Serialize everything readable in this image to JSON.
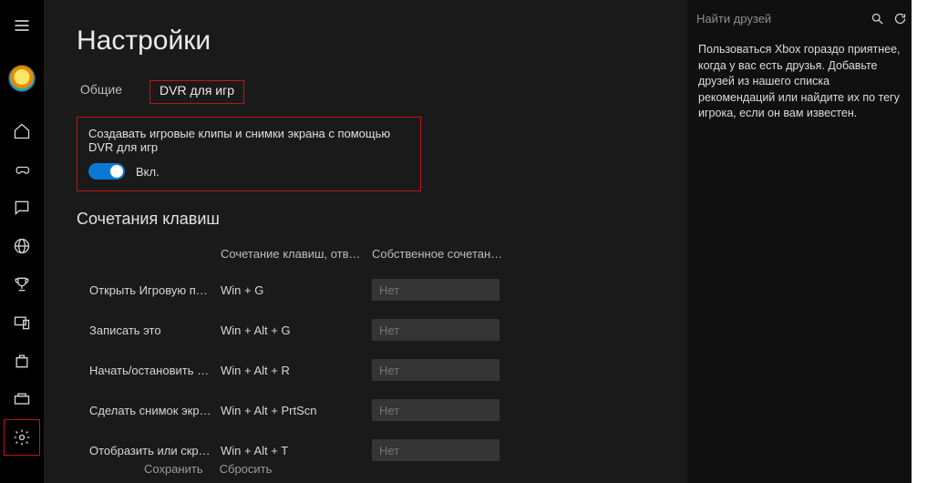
{
  "page": {
    "title": "Настройки"
  },
  "tabs": {
    "general": "Общие",
    "dvr": "DVR для игр"
  },
  "dvr": {
    "label": "Создавать игровые клипы и снимки экрана с помощью DVR для игр",
    "state": "Вкл."
  },
  "shortcuts": {
    "heading": "Сочетания клавиш",
    "col_default": "Сочетание клавиш, отве…",
    "col_custom": "Собственное сочетание к…",
    "rows": [
      {
        "name": "Открыть Игровую пан…",
        "default": "Win + G",
        "custom": "Нет"
      },
      {
        "name": "Записать это",
        "default": "Win + Alt + G",
        "custom": "Нет"
      },
      {
        "name": "Начать/остановить зап…",
        "default": "Win + Alt + R",
        "custom": "Нет"
      },
      {
        "name": "Сделать снимок экрана",
        "default": "Win + Alt + PrtScn",
        "custom": "Нет"
      },
      {
        "name": "Отобразить или скрыт…",
        "default": "Win + Alt + T",
        "custom": "Нет"
      }
    ]
  },
  "footer": {
    "save": "Сохранить",
    "reset": "Сбросить"
  },
  "right": {
    "placeholder": "Найти друзей",
    "message": "Пользоваться Xbox гораздо приятнее, когда у вас есть друзья. Добавьте друзей из нашего списка рекомендаций или найдите их по тегу игрока, если он вам известен."
  }
}
